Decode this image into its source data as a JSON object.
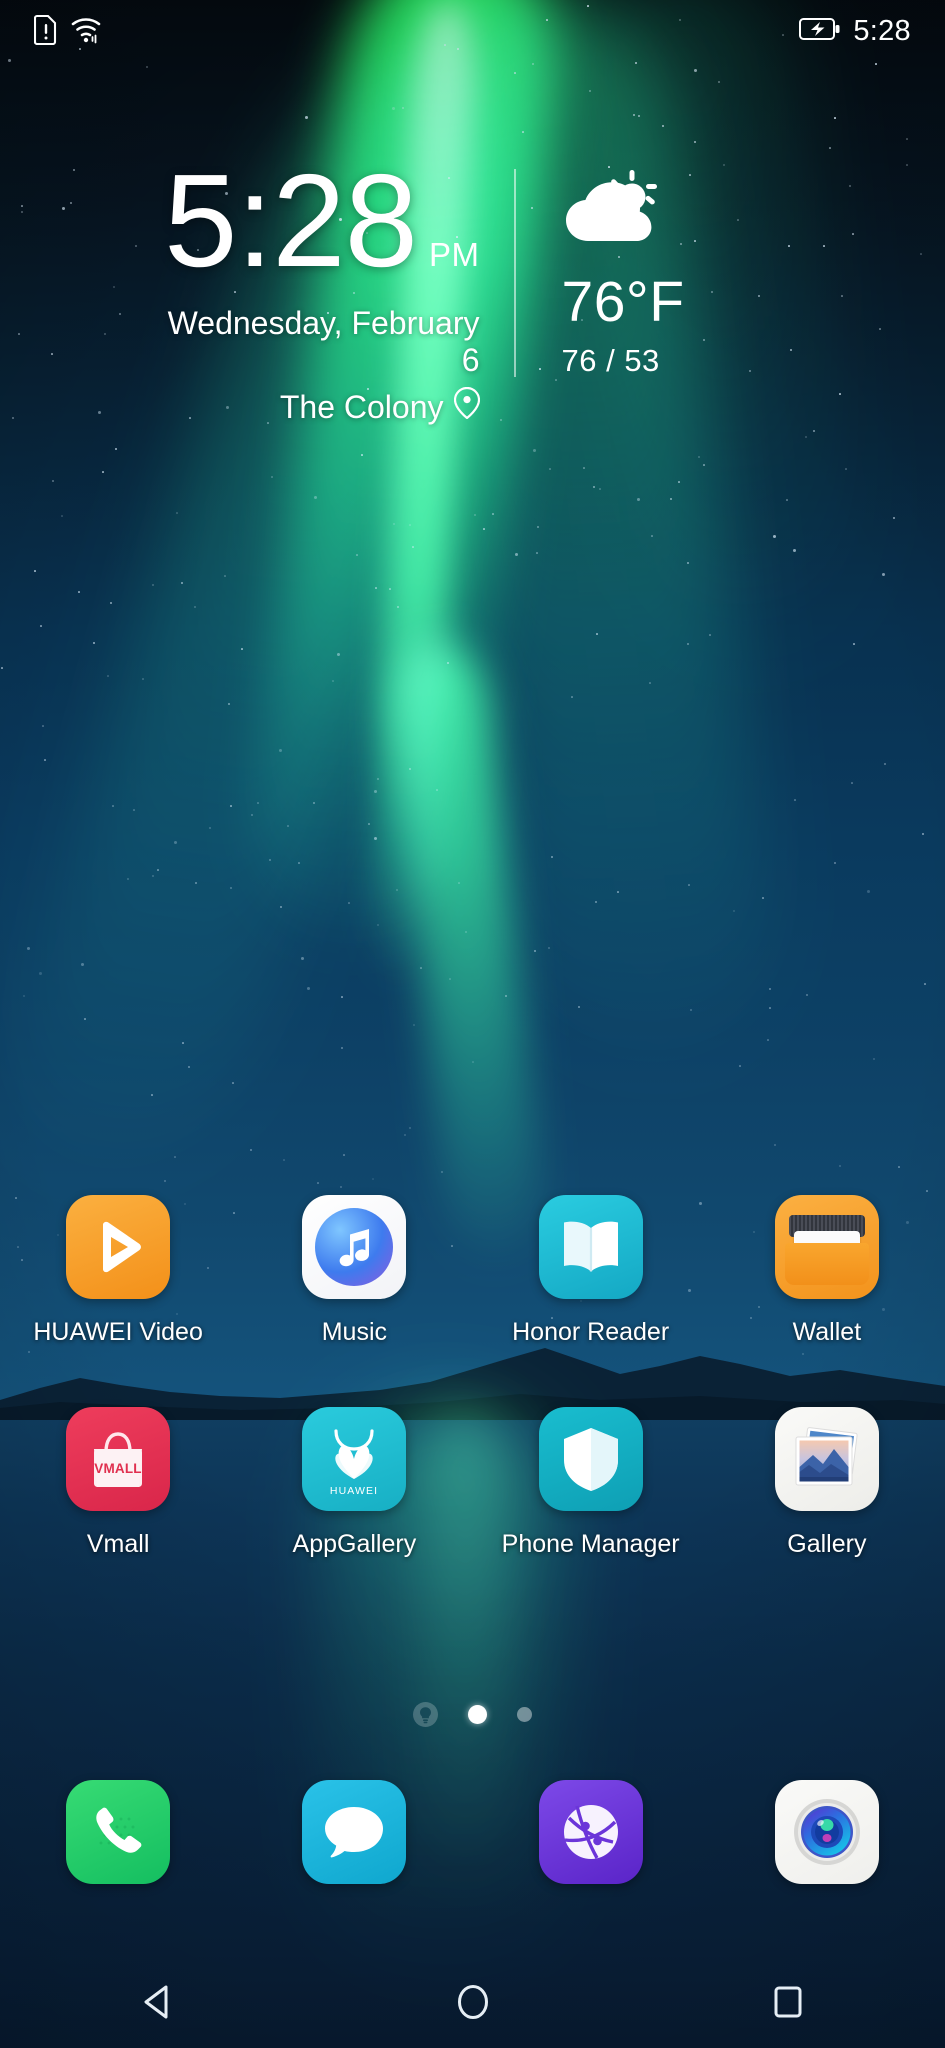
{
  "status_bar": {
    "time": "5:28",
    "icons_left": [
      "sim-card-alert-icon",
      "wifi-icon"
    ],
    "icons_right": [
      "battery-charging-icon"
    ]
  },
  "clock_widget": {
    "time": "5:28",
    "ampm": "PM",
    "date": "Wednesday, February 6",
    "location": "The Colony",
    "location_icon": "location-pin-icon",
    "weather": {
      "icon": "partly-cloudy-icon",
      "temperature": "76°F",
      "high_low": "76 / 53"
    }
  },
  "app_grid": {
    "rows": [
      [
        {
          "label": "HUAWEI Video",
          "icon": "huawei-video-icon"
        },
        {
          "label": "Music",
          "icon": "music-icon"
        },
        {
          "label": "Honor Reader",
          "icon": "honor-reader-icon"
        },
        {
          "label": "Wallet",
          "icon": "wallet-icon"
        }
      ],
      [
        {
          "label": "Vmall",
          "icon": "vmall-icon",
          "badge_text": "VMALL"
        },
        {
          "label": "AppGallery",
          "icon": "appgallery-icon",
          "badge_text": "HUAWEI"
        },
        {
          "label": "Phone Manager",
          "icon": "phone-manager-icon"
        },
        {
          "label": "Gallery",
          "icon": "gallery-icon"
        }
      ]
    ]
  },
  "page_indicator": {
    "dots": [
      {
        "type": "bulb",
        "active": false
      },
      {
        "type": "dot",
        "active": true
      },
      {
        "type": "dot",
        "active": false
      }
    ]
  },
  "dock": {
    "items": [
      {
        "name": "Phone",
        "icon": "phone-icon"
      },
      {
        "name": "Messages",
        "icon": "messages-icon"
      },
      {
        "name": "Browser",
        "icon": "browser-icon"
      },
      {
        "name": "Camera",
        "icon": "camera-icon"
      }
    ]
  },
  "nav_bar": {
    "buttons": [
      {
        "name": "Back",
        "icon": "back-triangle-icon"
      },
      {
        "name": "Home",
        "icon": "home-circle-icon"
      },
      {
        "name": "Recents",
        "icon": "recents-square-icon"
      }
    ]
  },
  "colors": {
    "wallpaper_sky": "#061420",
    "wallpaper_water": "#0a2744",
    "aurora_green": "#28ff5a",
    "huawei_video_orange": "#F6A01E",
    "honor_reader_cyan": "#19B6CE",
    "wallet_orange": "#F59A1E",
    "vmall_red": "#E23352",
    "appgallery_cyan": "#1EBFD0",
    "phone_manager_teal": "#12AEBF",
    "phone_green": "#2BD06A",
    "messages_cyan": "#15B5DB",
    "browser_purple": "#6B35D9",
    "text_white": "#ffffff"
  }
}
